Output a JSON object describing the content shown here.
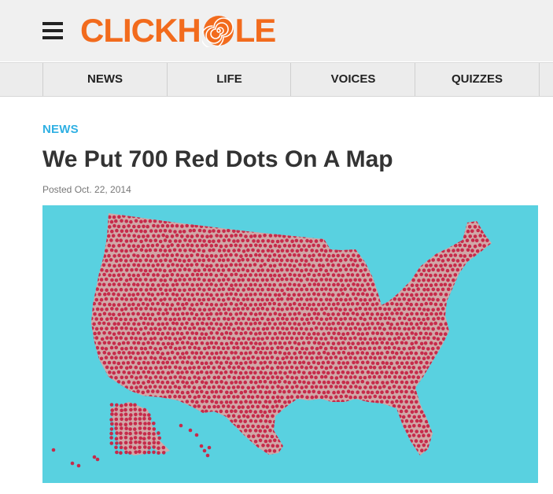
{
  "header": {
    "menu_icon": "hamburger-menu-icon",
    "logo_text": "CLICKH",
    "logo_tail": "LE",
    "logo_color": "#f26b1d"
  },
  "nav": {
    "items": [
      {
        "label": "NEWS"
      },
      {
        "label": "LIFE"
      },
      {
        "label": "VOICES"
      },
      {
        "label": "QUIZZES"
      }
    ]
  },
  "article": {
    "section": "NEWS",
    "section_color": "#2fb0e3",
    "title": "We Put 700 Red Dots On A Map",
    "posted": "Posted Oct. 22, 2014",
    "image": {
      "description_icon": "us-map-dots-image",
      "background_color": "#59d1e0",
      "land_color": "#d1a8a8",
      "dot_color": "#c62a4a"
    }
  }
}
